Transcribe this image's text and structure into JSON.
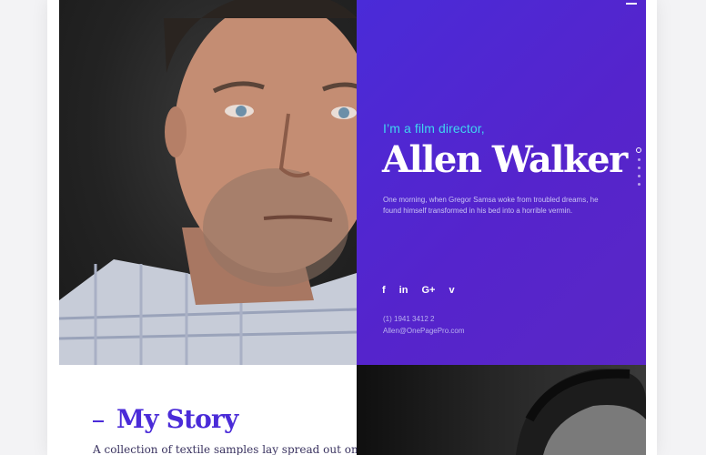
{
  "hero": {
    "intro": "I’m a film director,",
    "name": "Allen Walker",
    "bio": "One morning, when Gregor Samsa woke from troubled dreams, he found himself transformed in his bed into a horrible vermin.",
    "social": [
      {
        "name": "facebook-icon",
        "glyph": "f"
      },
      {
        "name": "linkedin-icon",
        "glyph": "in"
      },
      {
        "name": "google-plus-icon",
        "glyph": "G+"
      },
      {
        "name": "vimeo-icon",
        "glyph": "v"
      }
    ],
    "phone": "(1) 1941 3412 2",
    "email": "Allen@OnePagePro.com",
    "accent": "#4a2bd8",
    "intro_color": "#3fd5f0"
  },
  "story": {
    "title": "My Story",
    "text": "A collection of textile samples lay spread out on"
  }
}
